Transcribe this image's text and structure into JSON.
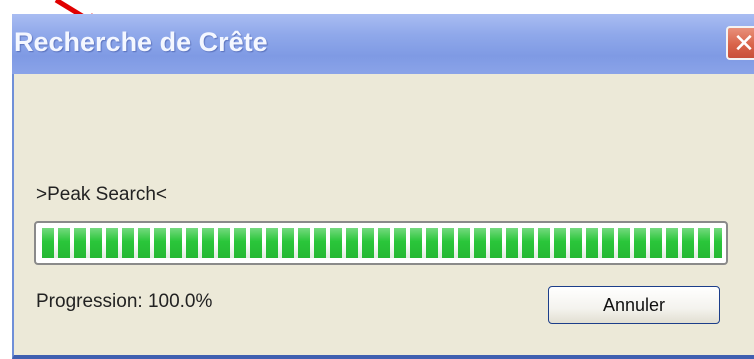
{
  "dialog": {
    "title": "Recherche de Crête",
    "close_glyph": "✕",
    "task_label": ">Peak Search<",
    "progress": {
      "value": 1.0,
      "text": "Progression: 100.0%"
    },
    "cancel_label": "Annuler"
  },
  "colors": {
    "titlebar": "#8fa8ea",
    "dialog_background": "#ece9d8",
    "progress_fill": "#2ac63a",
    "close_button": "#d9644a",
    "annotation_arrow": "#e00000"
  },
  "icons": {
    "annotation": "red-arrow-icon",
    "close": "close-icon"
  }
}
